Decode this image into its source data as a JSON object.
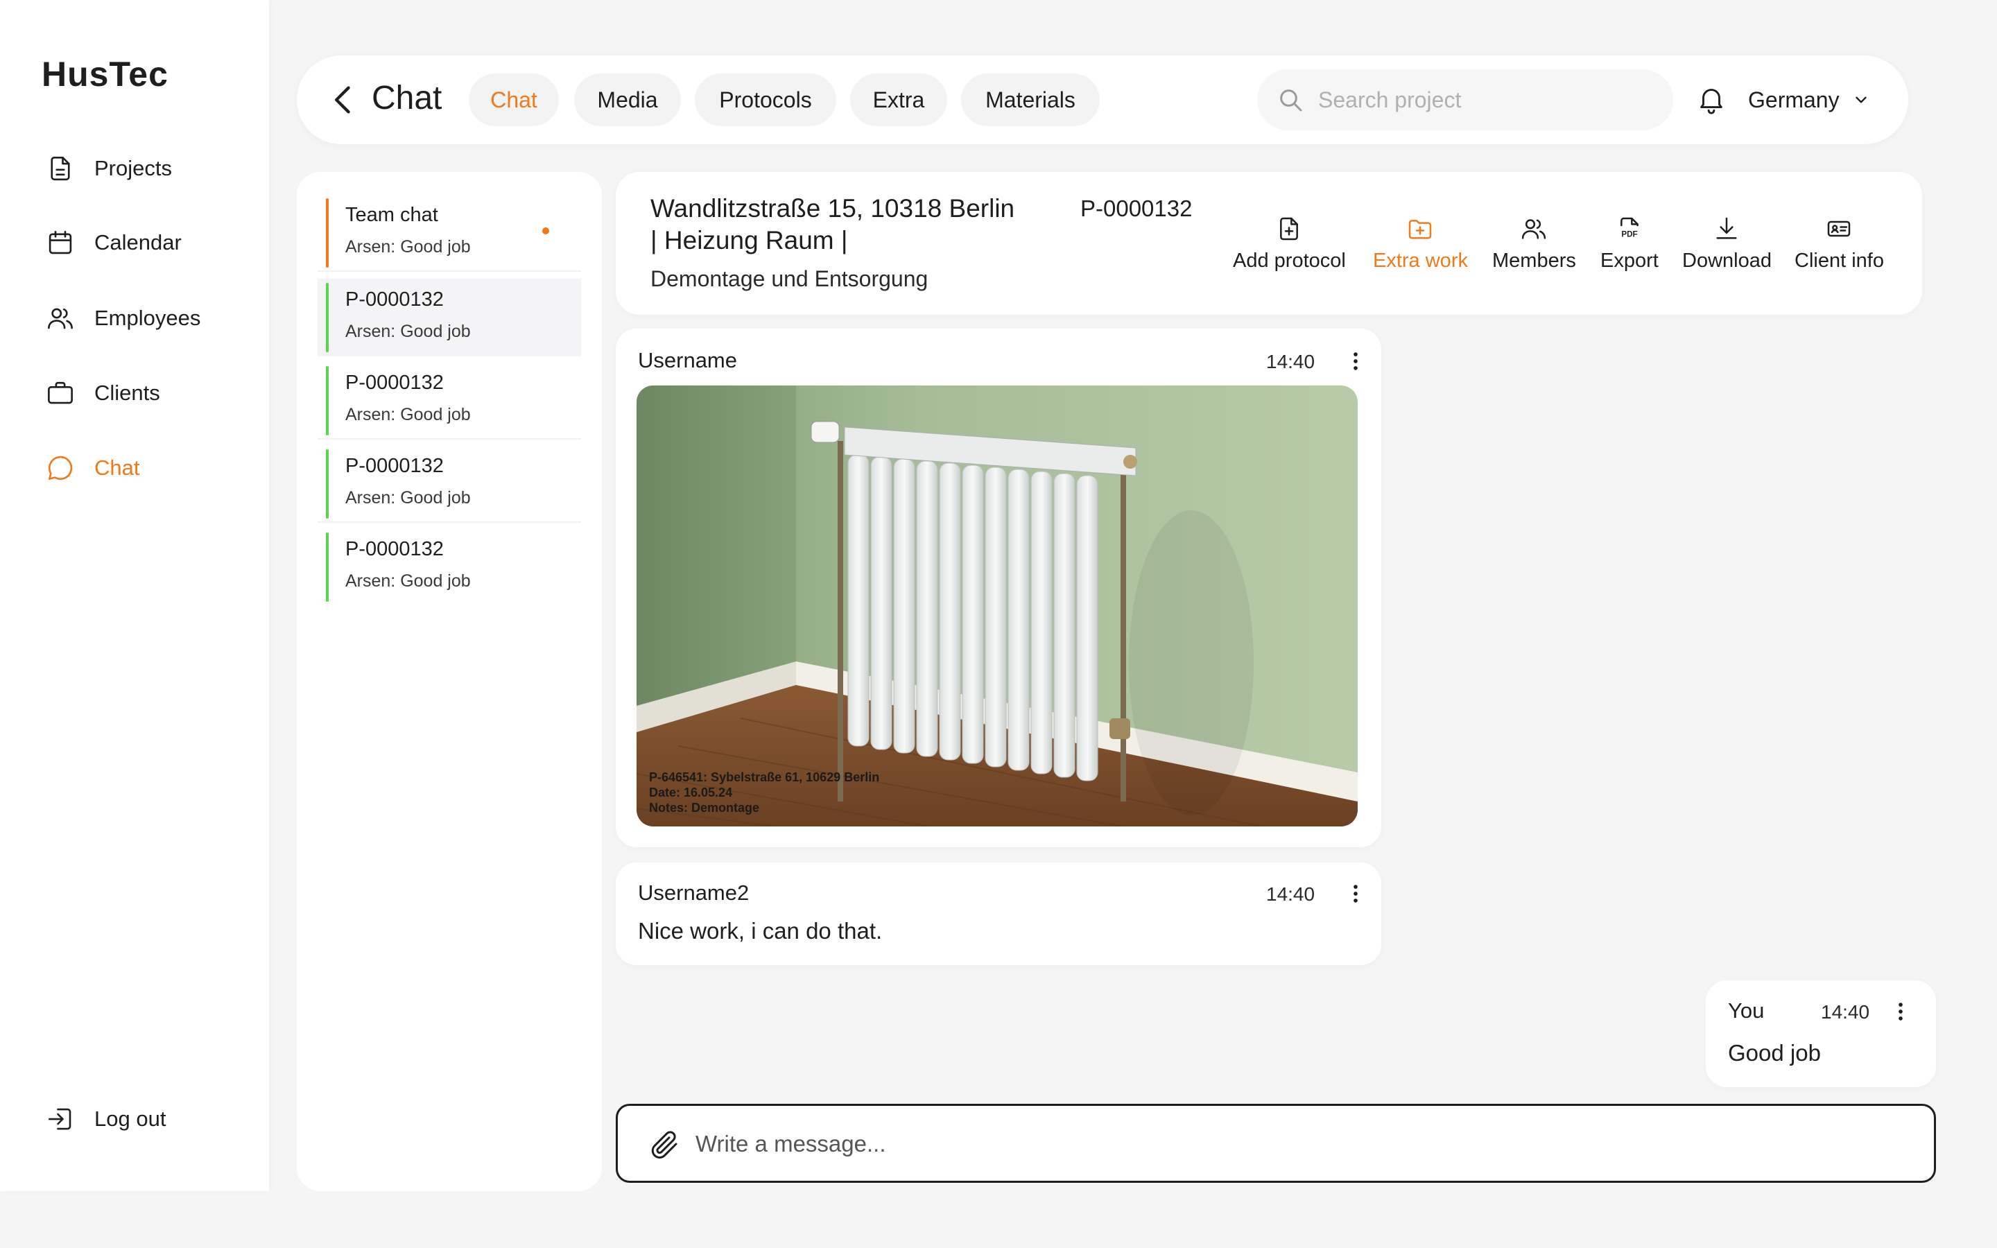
{
  "app": {
    "logo": "HusTec"
  },
  "sidebar": {
    "items": [
      {
        "label": "Projects",
        "icon": "document-icon"
      },
      {
        "label": "Calendar",
        "icon": "calendar-icon"
      },
      {
        "label": "Employees",
        "icon": "users-icon"
      },
      {
        "label": "Clients",
        "icon": "briefcase-icon"
      },
      {
        "label": "Chat",
        "icon": "chat-bubble-icon",
        "active": true
      }
    ],
    "logout_label": "Log out"
  },
  "header": {
    "title": "Chat",
    "tabs": [
      {
        "label": "Chat",
        "active": true
      },
      {
        "label": "Media"
      },
      {
        "label": "Protocols"
      },
      {
        "label": "Extra"
      },
      {
        "label": "Materials"
      }
    ],
    "search_placeholder": "Search project",
    "country": "Germany"
  },
  "conversations": [
    {
      "title": "Team chat",
      "preview": "Arsen: Good job",
      "unread": true
    },
    {
      "title": "P-0000132",
      "preview": "Arsen: Good job",
      "selected": true
    },
    {
      "title": "P-0000132",
      "preview": "Arsen: Good job"
    },
    {
      "title": "P-0000132",
      "preview": "Arsen: Good job"
    },
    {
      "title": "P-0000132",
      "preview": "Arsen: Good job"
    }
  ],
  "project": {
    "title_line1": "Wandlitzstraße 15, 10318 Berlin",
    "title_line2": "| Heizung Raum |",
    "id": "P-0000132",
    "subtitle": "Demontage und Entsorgung",
    "actions": [
      {
        "label": "Add protocol",
        "icon": "file-plus-icon"
      },
      {
        "label": "Extra work",
        "icon": "folder-plus-icon",
        "active": true
      },
      {
        "label": "Members",
        "icon": "users-icon"
      },
      {
        "label": "Export",
        "icon": "pdf-icon"
      },
      {
        "label": "Download",
        "icon": "download-icon"
      },
      {
        "label": "Client info",
        "icon": "id-card-icon"
      }
    ]
  },
  "messages": [
    {
      "user": "Username",
      "time": "14:40",
      "image_caption": [
        "P-646541: Sybelstraße 61, 10629 Berlin",
        "Date: 16.05.24",
        "Notes: Demontage"
      ]
    },
    {
      "user": "Username2",
      "time": "14:40",
      "text": "Nice work, i can do that."
    },
    {
      "user": "You",
      "time": "14:40",
      "text": "Good job"
    }
  ],
  "composer": {
    "placeholder": "Write a message..."
  },
  "colors": {
    "accent": "#f07a1a",
    "status_green": "#5bd34f",
    "background": "#f5f5f5",
    "card": "#ffffff"
  }
}
